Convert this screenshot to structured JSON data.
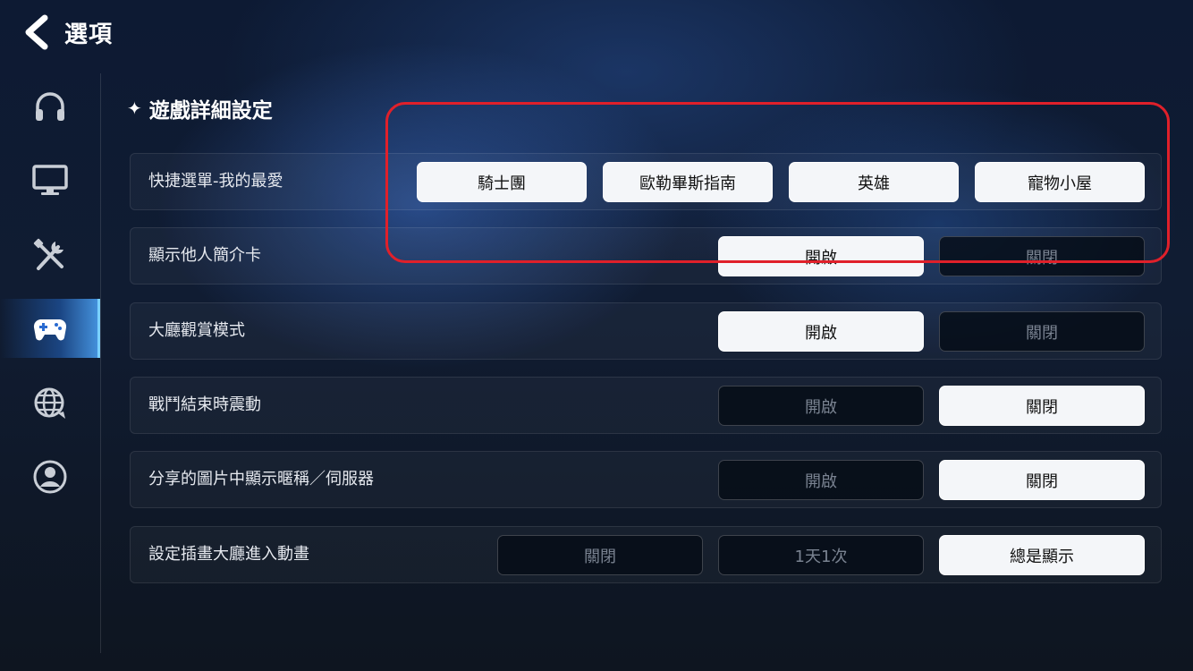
{
  "header": {
    "title": "選項",
    "back_icon": "chevron-left-icon"
  },
  "sidebar": {
    "items": [
      {
        "icon": "headphones-icon",
        "active": false
      },
      {
        "icon": "monitor-icon",
        "active": false
      },
      {
        "icon": "tools-icon",
        "active": false
      },
      {
        "icon": "gamepad-icon",
        "active": true
      },
      {
        "icon": "globe-chat-icon",
        "active": false
      },
      {
        "icon": "user-profile-icon",
        "active": false
      }
    ]
  },
  "section": {
    "star": "✦",
    "title": "遊戲詳細設定"
  },
  "rows": [
    {
      "label": "快捷選單-我的最愛",
      "buttons": [
        {
          "label": "騎士團",
          "state": "on"
        },
        {
          "label": "歐勒畢斯指南",
          "state": "on"
        },
        {
          "label": "英雄",
          "state": "on"
        },
        {
          "label": "寵物小屋",
          "state": "on"
        }
      ]
    },
    {
      "label": "顯示他人簡介卡",
      "buttons": [
        {
          "label": "開啟",
          "state": "on"
        },
        {
          "label": "關閉",
          "state": "off"
        }
      ]
    },
    {
      "label": "大廳觀賞模式",
      "buttons": [
        {
          "label": "開啟",
          "state": "on"
        },
        {
          "label": "關閉",
          "state": "off"
        }
      ]
    },
    {
      "label": "戰鬥結束時震動",
      "buttons": [
        {
          "label": "開啟",
          "state": "off"
        },
        {
          "label": "關閉",
          "state": "on"
        }
      ]
    },
    {
      "label": "分享的圖片中顯示暱稱／伺服器",
      "buttons": [
        {
          "label": "開啟",
          "state": "off"
        },
        {
          "label": "關閉",
          "state": "on"
        }
      ]
    },
    {
      "label": "設定插畫大廳進入動畫",
      "buttons": [
        {
          "label": "關閉",
          "state": "off"
        },
        {
          "label": "1天1次",
          "state": "off"
        },
        {
          "label": "總是顯示",
          "state": "on"
        }
      ]
    }
  ],
  "colors": {
    "highlight": "#e0202a",
    "active_accent": "#7ad0ff",
    "button_on": "#f4f6f9"
  }
}
